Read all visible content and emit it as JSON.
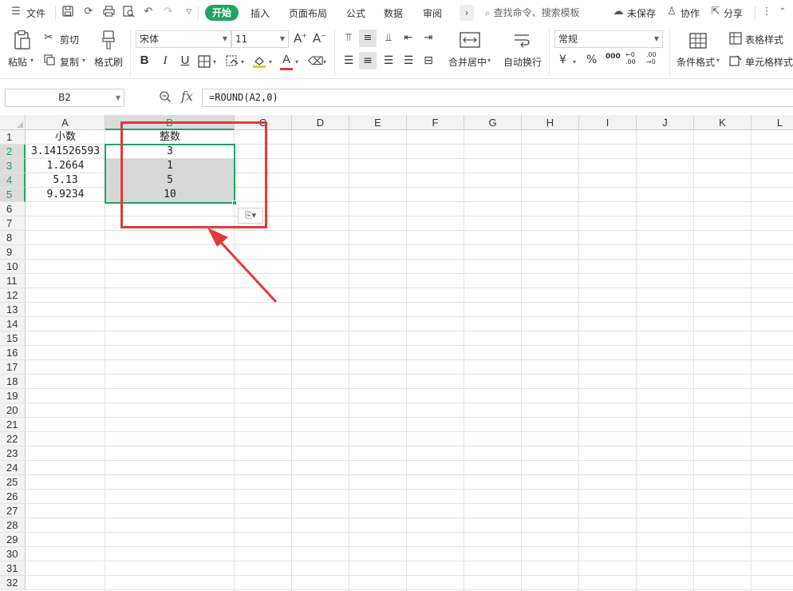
{
  "menubar": {
    "file": "文件",
    "tabs": [
      "开始",
      "插入",
      "页面布局",
      "公式",
      "数据",
      "审阅"
    ],
    "search_placeholder": "查找命令、搜索模板",
    "unsaved": "未保存",
    "collaborate": "协作",
    "share": "分享"
  },
  "ribbon": {
    "paste": "粘贴",
    "cut": "剪切",
    "copy": "复制",
    "format_painter": "格式刷",
    "font_name": "宋体",
    "font_size": "11",
    "merge_center": "合并居中",
    "wrap_text": "自动换行",
    "number_format": "常规",
    "conditional_format": "条件格式",
    "table_style": "表格样式",
    "cell_style": "单元格样式",
    "bold": "B",
    "italic": "I",
    "underline": "U",
    "font_color": "A",
    "currency": "¥",
    "percent": "%",
    "thousands": "000",
    "dec_inc": "←0 .00",
    "dec_dec": ".00 →0"
  },
  "formula_bar": {
    "cell_ref": "B2",
    "formula": "=ROUND(A2,0)",
    "fx": "fx"
  },
  "grid": {
    "columns": [
      "A",
      "B",
      "C",
      "D",
      "E",
      "F",
      "G",
      "H",
      "I",
      "J",
      "K",
      "L"
    ],
    "rows": [
      "1",
      "2",
      "3",
      "4",
      "5",
      "6",
      "7",
      "8",
      "9",
      "10",
      "11",
      "12",
      "13",
      "14",
      "15",
      "16",
      "17",
      "18",
      "19",
      "20",
      "21",
      "22",
      "23",
      "24",
      "25",
      "26",
      "27",
      "28",
      "29",
      "30",
      "31",
      "32"
    ],
    "headers": {
      "A": "小数",
      "B": "整数"
    },
    "data": [
      {
        "a": "3.141526593",
        "b": "3"
      },
      {
        "a": "1.2664",
        "b": "1"
      },
      {
        "a": "5.13",
        "b": "5"
      },
      {
        "a": "9.9234",
        "b": "10"
      }
    ]
  },
  "colors": {
    "accent_green": "#1fa463",
    "annotation_red": "#e53935"
  }
}
